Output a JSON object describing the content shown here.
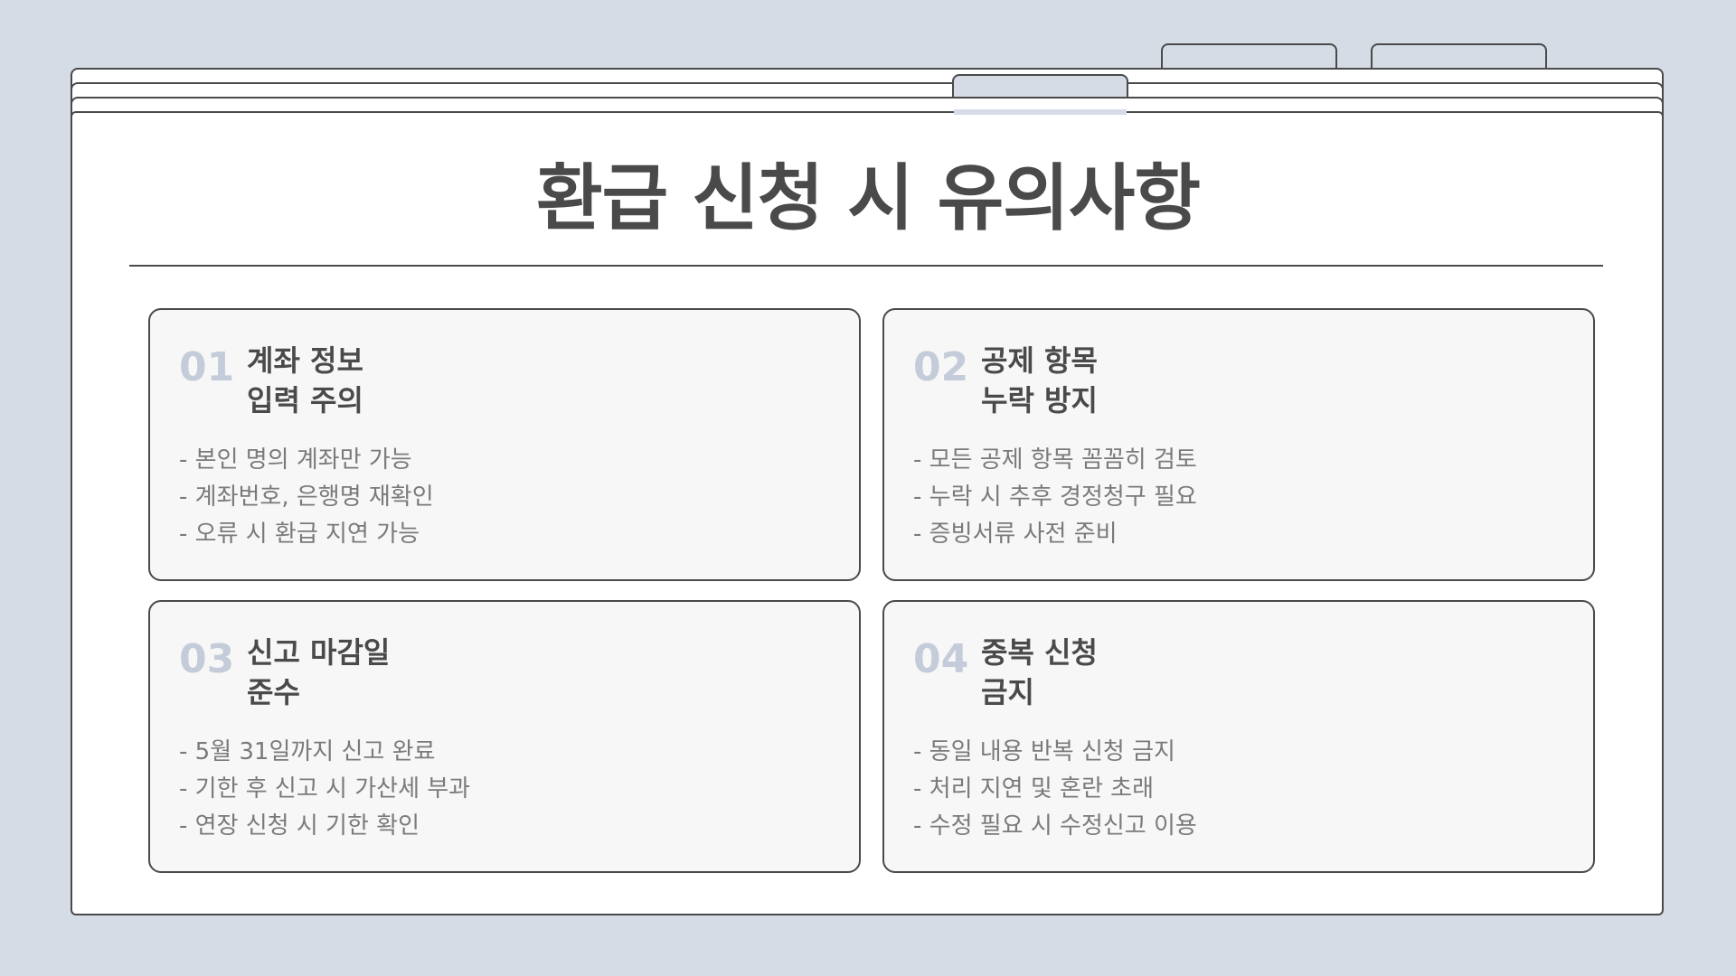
{
  "title": "환급 신청 시 유의사항",
  "cards": [
    {
      "number": "01",
      "title_line1": "계좌 정보",
      "title_line2": "입력 주의",
      "items": [
        "- 본인 명의 계좌만 가능",
        "- 계좌번호, 은행명 재확인",
        "- 오류 시 환급 지연 가능"
      ]
    },
    {
      "number": "02",
      "title_line1": "공제 항목",
      "title_line2": "누락 방지",
      "items": [
        "- 모든 공제 항목 꼼꼼히 검토",
        "- 누락 시 추후 경정청구 필요",
        "- 증빙서류 사전 준비"
      ]
    },
    {
      "number": "03",
      "title_line1": "신고 마감일",
      "title_line2": "준수",
      "items": [
        "- 5월 31일까지 신고 완료",
        "- 기한 후 신고 시 가산세 부과",
        "- 연장 신청 시 기한 확인"
      ]
    },
    {
      "number": "04",
      "title_line1": "중복 신청",
      "title_line2": "금지",
      "items": [
        "- 동일 내용 반복 신청 금지",
        "- 처리 지연 및 혼란 초래",
        "- 수정 필요 시 수정신고 이용"
      ]
    }
  ],
  "colors": {
    "background": "#d5dce5",
    "border": "#4a4a4a",
    "number": "#c3ccd8",
    "text": "#7a7a7a",
    "card": "#f7f7f7"
  }
}
